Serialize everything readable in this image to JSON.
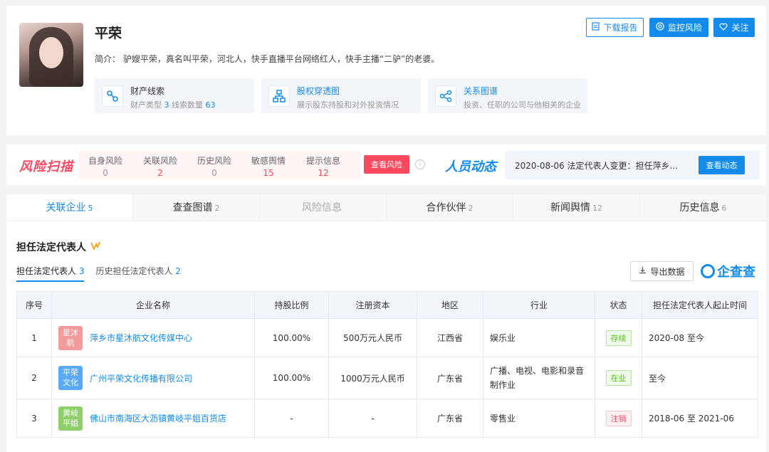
{
  "profile": {
    "name": "平荣",
    "intro": "简介： 驴嫂平荣，真名叫平荣，河北人，快手直播平台网络红人，快手主播“二驴”的老婆。",
    "features": [
      {
        "title": "财产线索",
        "sub_a": "财产类型 ",
        "val_a": "3",
        "sub_b": "  线索数量 ",
        "val_b": "63",
        "icon": "link-icon"
      },
      {
        "title": "股权穿透图",
        "sub": "展示股东持股和对外投资情况",
        "icon": "org-chart-icon"
      },
      {
        "title": "关系图谱",
        "sub": "投资、任职的公司与他相关的企业",
        "icon": "share-icon"
      }
    ],
    "buttons": {
      "download": "下载报告",
      "monitor": "监控风险",
      "follow": "关注"
    }
  },
  "risk": {
    "logo": "风险扫描",
    "items": [
      {
        "label": "自身风险",
        "value": "0",
        "color": "#999999"
      },
      {
        "label": "关联风险",
        "value": "2",
        "color": "#fd485e"
      },
      {
        "label": "历史风险",
        "value": "0",
        "color": "#999999"
      },
      {
        "label": "敏感舆情",
        "value": "15",
        "color": "#fd485e"
      },
      {
        "label": "提示信息",
        "value": "12",
        "color": "#fd485e"
      }
    ],
    "button": "查看风险",
    "info_glyph": "i"
  },
  "people": {
    "logo": "人员动态",
    "text": "2020-08-06 法定代表人变更：担任萍乡...",
    "button": "查看动态"
  },
  "tabs": [
    {
      "label": "关联企业",
      "count": "5",
      "state": "active"
    },
    {
      "label": "查查图谱",
      "count": "2",
      "state": ""
    },
    {
      "label": "风险信息",
      "count": "",
      "state": "disabled"
    },
    {
      "label": "合作伙伴",
      "count": "2",
      "state": ""
    },
    {
      "label": "新闻舆情",
      "count": "12",
      "state": ""
    },
    {
      "label": "历史信息",
      "count": "6",
      "state": ""
    }
  ],
  "section": {
    "title": "担任法定代表人",
    "subtabs": [
      {
        "label": "担任法定代表人 ",
        "count": "3"
      },
      {
        "label": "历史担任法定代表人 ",
        "count": "2"
      }
    ],
    "export": "导出数据",
    "brand": "企查查"
  },
  "table": {
    "headers": [
      "序号",
      "企业名称",
      "持股比例",
      "注册资本",
      "地区",
      "行业",
      "状态",
      "担任法定代表人起止时间"
    ],
    "rows": [
      {
        "no": "1",
        "logo": "星沐航",
        "logo_color": "#f39a9a",
        "name": "萍乡市星沐航文化传媒中心",
        "share": "100.00%",
        "capital": "500万元人民币",
        "region": "江西省",
        "industry": "娱乐业",
        "status": "存续",
        "status_color": "#52c41a",
        "period": "2020-08 至今"
      },
      {
        "no": "2",
        "logo": "平荣文化",
        "logo_color": "#5aa9f5",
        "name": "广州平荣文化传播有限公司",
        "share": "100.00%",
        "capital": "1000万元人民币",
        "region": "广东省",
        "industry": "广播、电视、电影和录音制作业",
        "status": "在业",
        "status_color": "#52c41a",
        "period": "至今"
      },
      {
        "no": "3",
        "logo": "黄岐平姐",
        "logo_color": "#8fcf6b",
        "name": "佛山市南海区大沥镇黄岐平姐百货店",
        "share": "-",
        "capital": "-",
        "region": "广东省",
        "industry": "零售业",
        "status": "注销",
        "status_color": "#fd485e",
        "period": "2018-06 至 2021-06"
      }
    ]
  },
  "colors": {
    "brand": "#128bed",
    "danger": "#fd485e"
  }
}
